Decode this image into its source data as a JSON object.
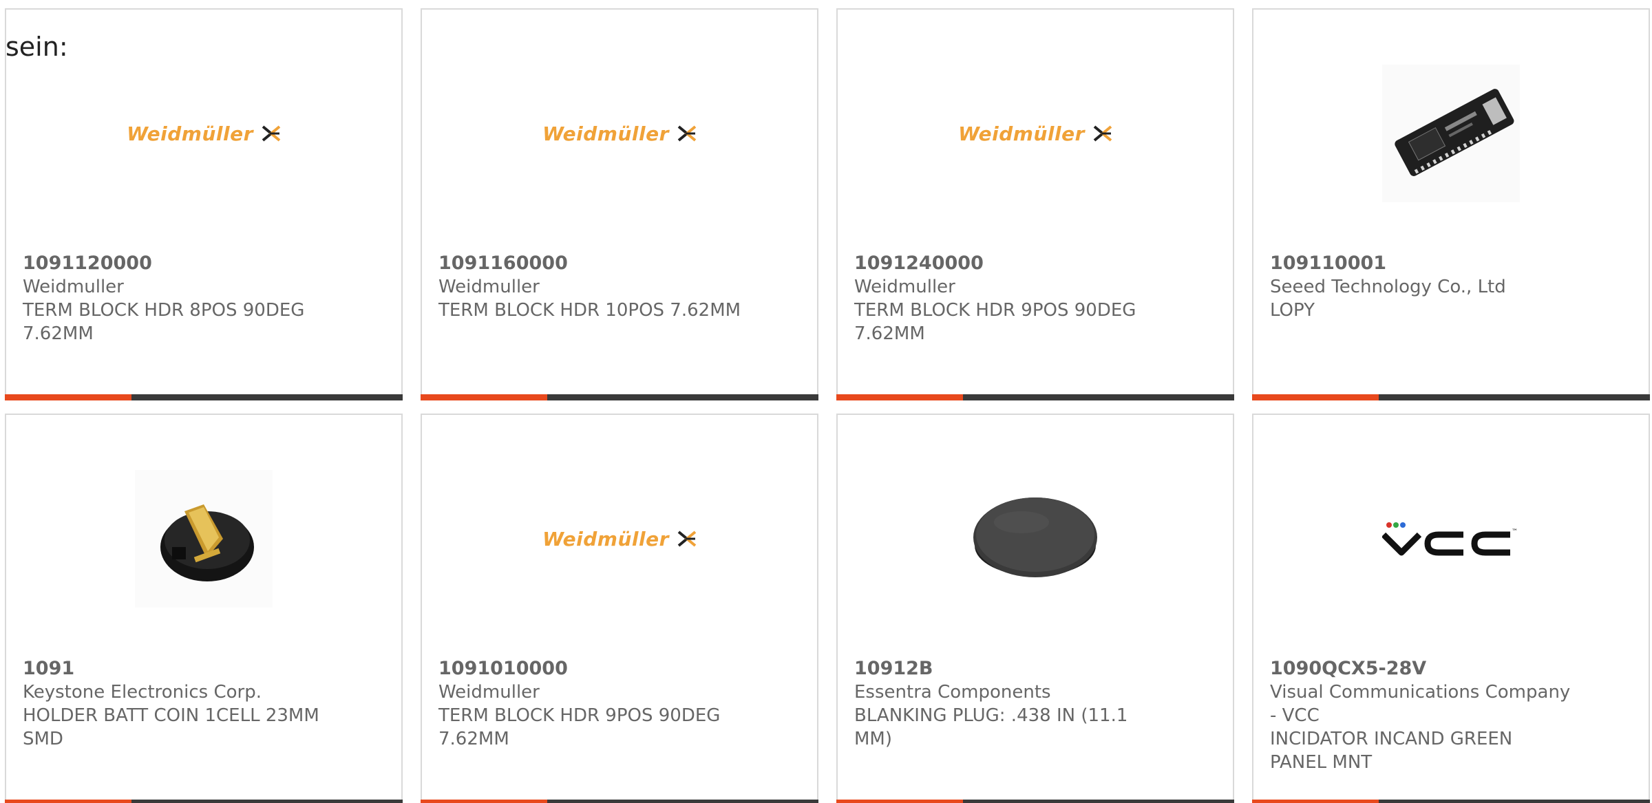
{
  "intro_text": "sein:",
  "colors": {
    "accent": "#e8491d",
    "bar_dark": "#3a3a3a",
    "weidmuller_orange": "#f0a238",
    "text_gray": "#666666"
  },
  "products": [
    {
      "part_number": "1091120000",
      "manufacturer": "Weidmuller",
      "description_line1": "TERM BLOCK HDR 8POS 90DEG",
      "description_line2": "7.62MM",
      "image": "weidmuller-logo",
      "logo_text": "Weidmüller"
    },
    {
      "part_number": "1091160000",
      "manufacturer": "Weidmuller",
      "description_line1": "TERM BLOCK HDR 10POS 7.62MM",
      "description_line2": "",
      "image": "weidmuller-logo",
      "logo_text": "Weidmüller"
    },
    {
      "part_number": "1091240000",
      "manufacturer": "Weidmuller",
      "description_line1": "TERM BLOCK HDR 9POS 90DEG",
      "description_line2": "7.62MM",
      "image": "weidmuller-logo",
      "logo_text": "Weidmüller"
    },
    {
      "part_number": "109110001",
      "manufacturer": "Seeed Technology Co., Ltd",
      "description_line1": "LOPY",
      "description_line2": "",
      "image": "dev-board-photo"
    },
    {
      "part_number": "1091",
      "manufacturer": "Keystone Electronics Corp.",
      "description_line1": "HOLDER BATT COIN 1CELL 23MM",
      "description_line2": "SMD",
      "image": "coin-holder-photo"
    },
    {
      "part_number": "1091010000",
      "manufacturer": "Weidmuller",
      "description_line1": "TERM BLOCK HDR 9POS 90DEG",
      "description_line2": "7.62MM",
      "image": "weidmuller-logo",
      "logo_text": "Weidmüller"
    },
    {
      "part_number": "10912B",
      "manufacturer": "Essentra Components",
      "description_line1": "BLANKING PLUG: .438 IN (11.1",
      "description_line2": "MM)",
      "image": "blanking-plug-photo"
    },
    {
      "part_number": "1090QCX5-28V",
      "manufacturer": "Visual Communications Company",
      "manufacturer_line2": "- VCC",
      "description_line1": "INCIDATOR INCAND GREEN",
      "description_line2": "PANEL MNT",
      "image": "vcc-logo"
    }
  ]
}
